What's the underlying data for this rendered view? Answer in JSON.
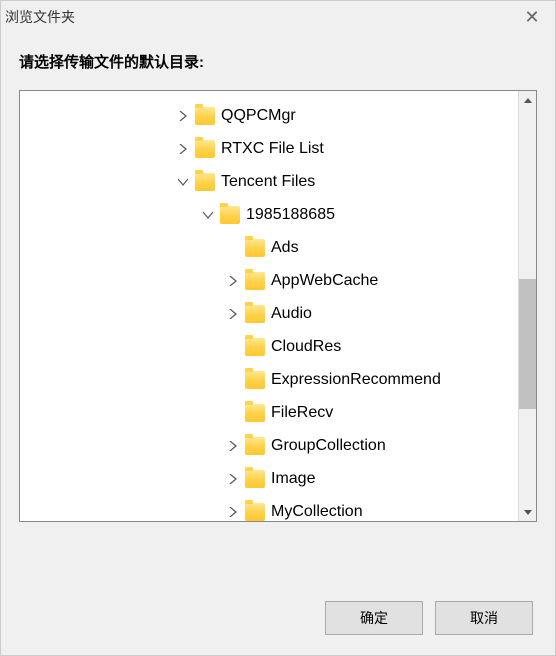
{
  "dialog": {
    "title": "浏览文件夹",
    "instruction": "请选择传输文件的默认目录:"
  },
  "tree": [
    {
      "level": 0,
      "expander": "closed",
      "label": "QQPCMgr"
    },
    {
      "level": 0,
      "expander": "closed",
      "label": "RTXC File List"
    },
    {
      "level": 0,
      "expander": "open",
      "label": "Tencent Files"
    },
    {
      "level": 1,
      "expander": "open",
      "label": "1985188685"
    },
    {
      "level": 2,
      "expander": "none",
      "label": "Ads"
    },
    {
      "level": 2,
      "expander": "closed",
      "label": "AppWebCache"
    },
    {
      "level": 2,
      "expander": "closed",
      "label": "Audio"
    },
    {
      "level": 2,
      "expander": "none",
      "label": "CloudRes"
    },
    {
      "level": 2,
      "expander": "none",
      "label": "ExpressionRecommend"
    },
    {
      "level": 2,
      "expander": "none",
      "label": "FileRecv"
    },
    {
      "level": 2,
      "expander": "closed",
      "label": "GroupCollection"
    },
    {
      "level": 2,
      "expander": "closed",
      "label": "Image"
    },
    {
      "level": 2,
      "expander": "closed",
      "label": "MyCollection"
    }
  ],
  "buttons": {
    "ok": "确定",
    "cancel": "取消"
  },
  "indent": {
    "base": 155,
    "step": 25
  }
}
